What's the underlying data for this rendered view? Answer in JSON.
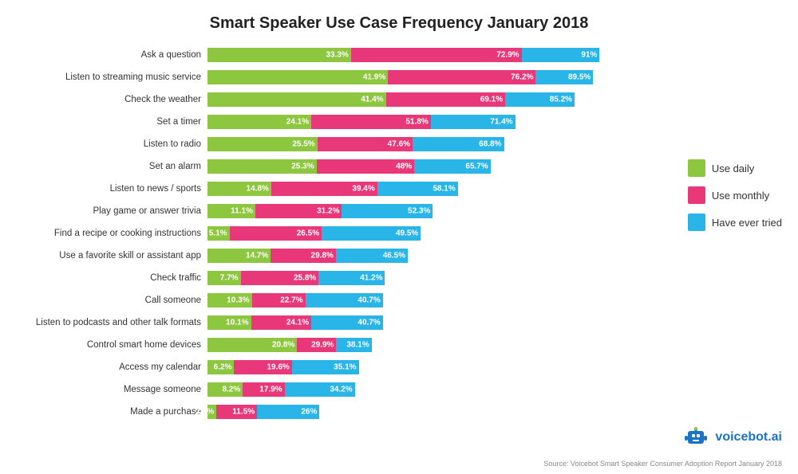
{
  "title": "Smart Speaker Use Case Frequency January 2018",
  "colors": {
    "tried": "#29b5e8",
    "monthly": "#e8387a",
    "daily": "#8dc63f"
  },
  "legend": {
    "daily": "Use daily",
    "monthly": "Use monthly",
    "tried": "Have ever tried"
  },
  "rows": [
    {
      "label": "Ask a question",
      "tried": 91,
      "monthly": 72.9,
      "daily": 33.3
    },
    {
      "label": "Listen to streaming music service",
      "tried": 89.5,
      "monthly": 76.2,
      "daily": 41.9
    },
    {
      "label": "Check the weather",
      "tried": 85.2,
      "monthly": 69.1,
      "daily": 41.4
    },
    {
      "label": "Set a timer",
      "tried": 71.4,
      "monthly": 51.8,
      "daily": 24.1
    },
    {
      "label": "Listen to radio",
      "tried": 68.8,
      "monthly": 47.6,
      "daily": 25.5
    },
    {
      "label": "Set an alarm",
      "tried": 65.7,
      "monthly": 48,
      "daily": 25.3
    },
    {
      "label": "Listen to news / sports",
      "tried": 58.1,
      "monthly": 39.4,
      "daily": 14.8
    },
    {
      "label": "Play game or answer trivia",
      "tried": 52.3,
      "monthly": 31.2,
      "daily": 11.1
    },
    {
      "label": "Find a recipe or cooking instructions",
      "tried": 49.5,
      "monthly": 26.5,
      "daily": 5.1
    },
    {
      "label": "Use a favorite skill or assistant app",
      "tried": 46.5,
      "monthly": 29.8,
      "daily": 14.7
    },
    {
      "label": "Check traffic",
      "tried": 41.2,
      "monthly": 25.8,
      "daily": 7.7
    },
    {
      "label": "Call someone",
      "tried": 40.7,
      "monthly": 22.7,
      "daily": 10.3
    },
    {
      "label": "Listen to podcasts and other talk formats",
      "tried": 40.7,
      "monthly": 24.1,
      "daily": 10.1
    },
    {
      "label": "Control smart home devices",
      "tried": 38.1,
      "monthly": 29.9,
      "daily": 20.8
    },
    {
      "label": "Access my calendar",
      "tried": 35.1,
      "monthly": 19.6,
      "daily": 6.2
    },
    {
      "label": "Message someone",
      "tried": 34.2,
      "monthly": 17.9,
      "daily": 8.2
    },
    {
      "label": "Made a purchase",
      "tried": 26,
      "monthly": 11.5,
      "daily": 2.1
    }
  ],
  "source": "Source: Voicebot Smart Speaker Consumer Adoption Report January 2018",
  "max_val": 100
}
